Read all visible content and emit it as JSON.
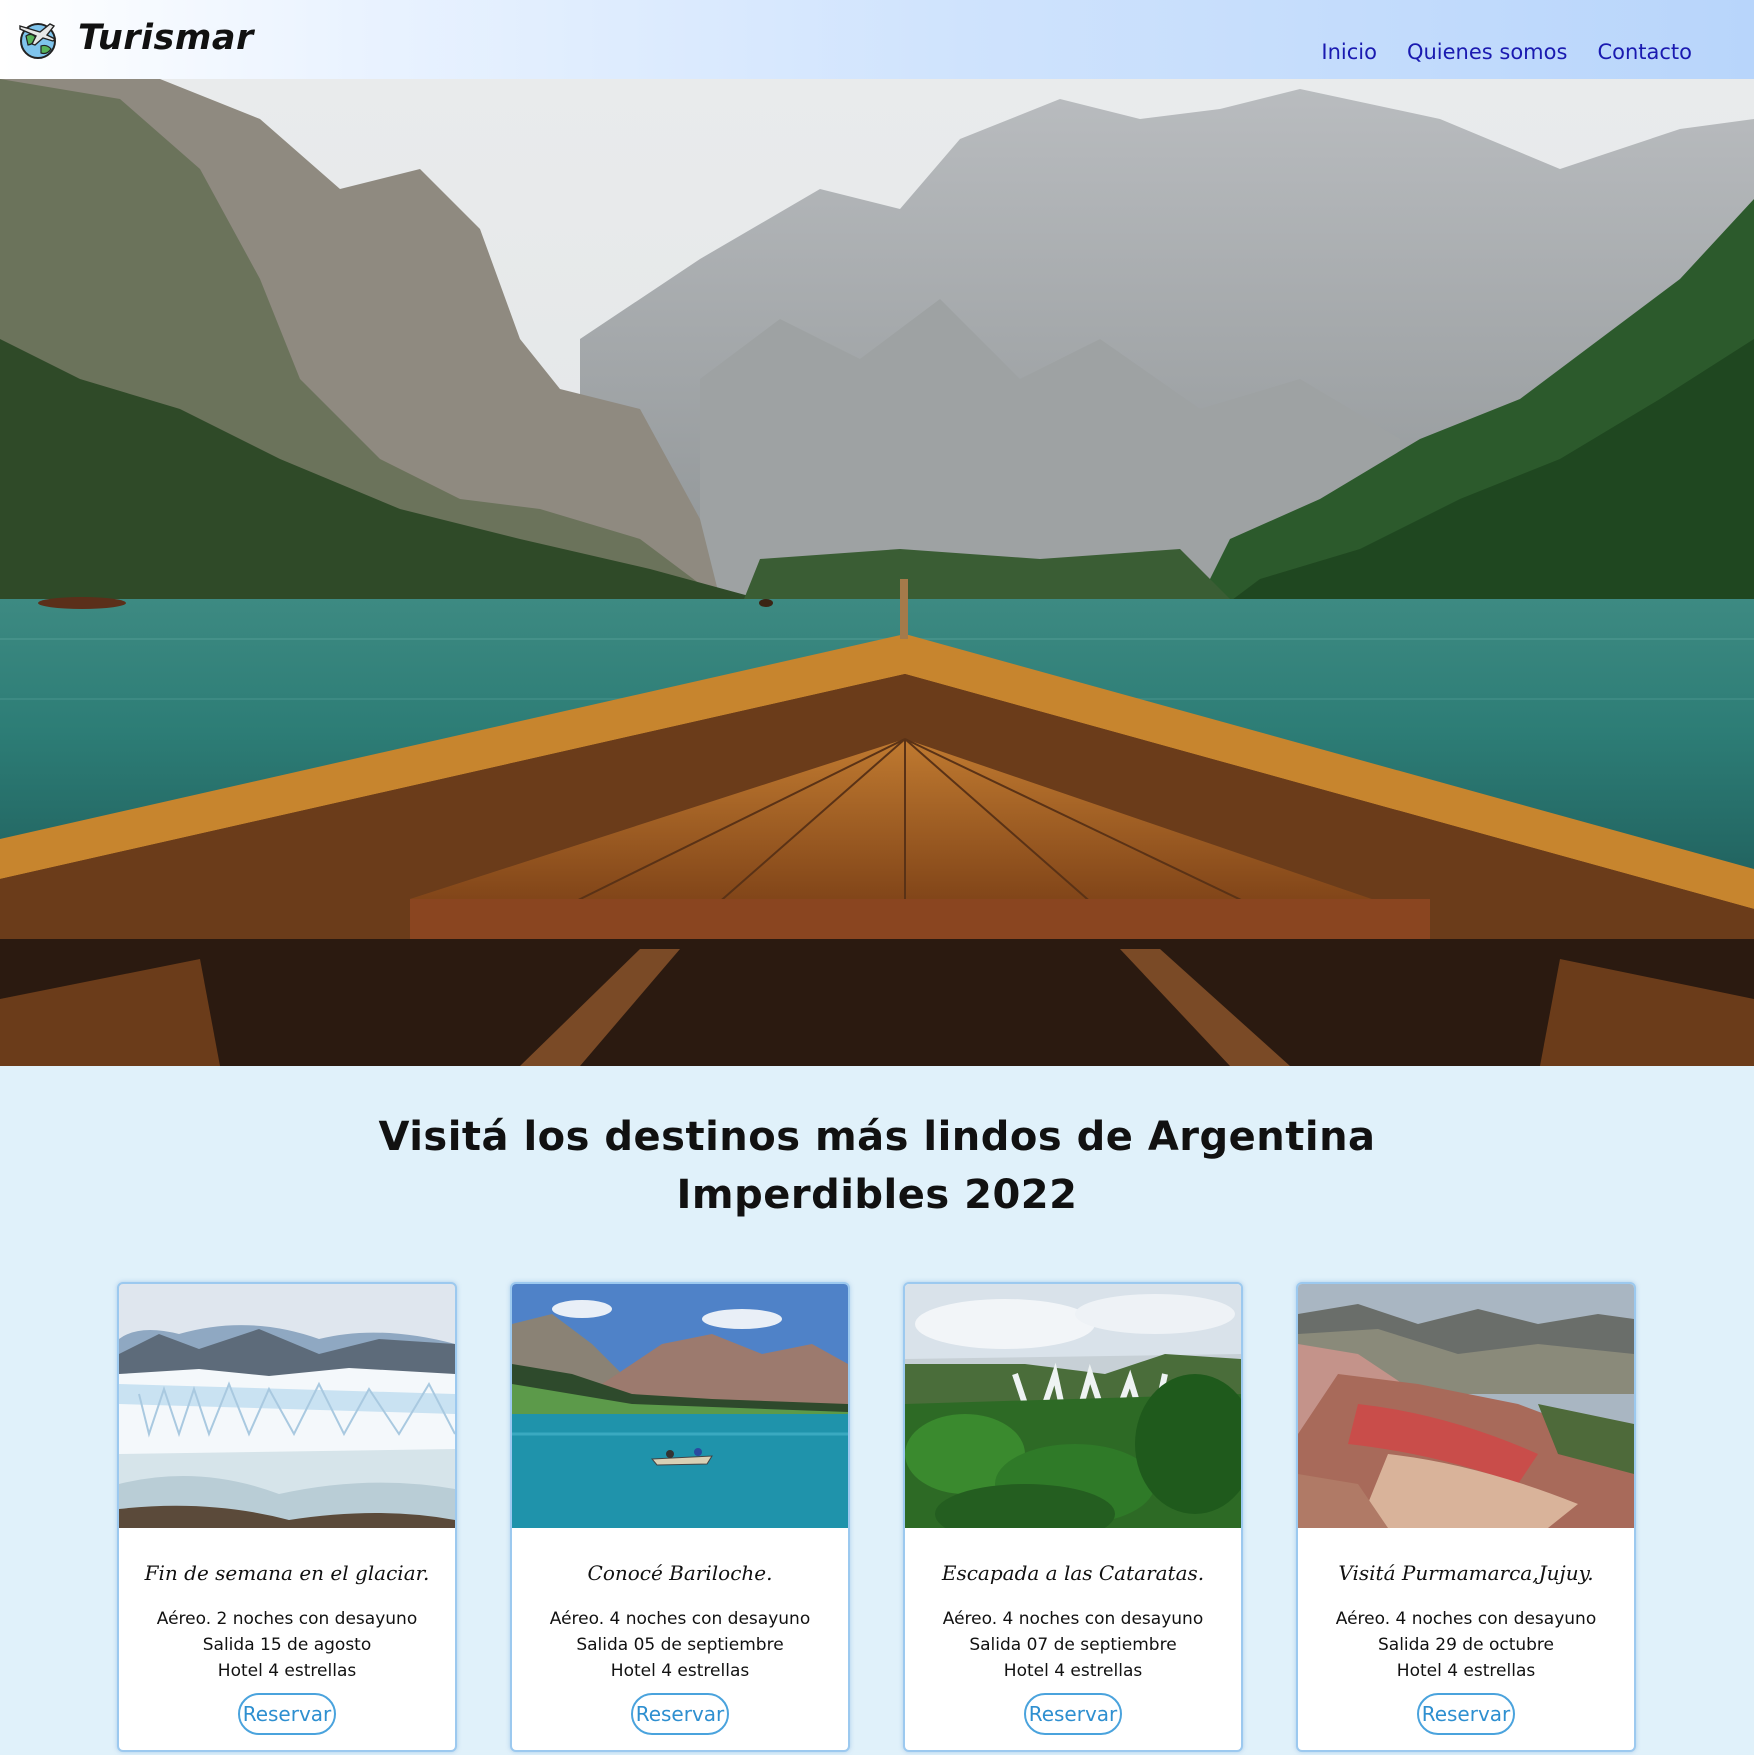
{
  "brand": {
    "name": "Turismar",
    "logo_icon": "globe-airplane-icon"
  },
  "nav": {
    "items": [
      "Inicio",
      "Quienes somos",
      "Contacto"
    ]
  },
  "hero": {
    "image": "mountain-lake-boat-bow"
  },
  "headings": {
    "title": "Visitá los destinos más lindos de Argentina",
    "subtitle": "Imperdibles 2022"
  },
  "cards": [
    {
      "image": "glacier-perito-moreno",
      "title": "Fin de semana en el glaciar.",
      "lines": [
        "Aéreo. 2 noches con desayuno",
        "Salida 15 de agosto",
        "Hotel 4 estrellas"
      ],
      "button": "Reservar"
    },
    {
      "image": "bariloche-lake-canoe",
      "title": "Conocé Bariloche.",
      "lines": [
        "Aéreo. 4 noches con desayuno",
        "Salida 05 de septiembre",
        "Hotel 4 estrellas"
      ],
      "button": "Reservar"
    },
    {
      "image": "iguazu-falls",
      "title": "Escapada a las Cataratas.",
      "lines": [
        "Aéreo. 4 noches con desayuno",
        "Salida 07 de septiembre",
        "Hotel 4 estrellas"
      ],
      "button": "Reservar"
    },
    {
      "image": "purmamarca-hills",
      "title": "Visitá Purmamarca,Jujuy.",
      "lines": [
        "Aéreo. 4 noches con desayuno",
        "Salida 29 de octubre",
        "Hotel 4 estrellas"
      ],
      "button": "Reservar"
    }
  ],
  "colors": {
    "page_bg": "#e0f1fa",
    "nav_link": "#1a1ab0",
    "button_accent": "#2e8fd0"
  }
}
